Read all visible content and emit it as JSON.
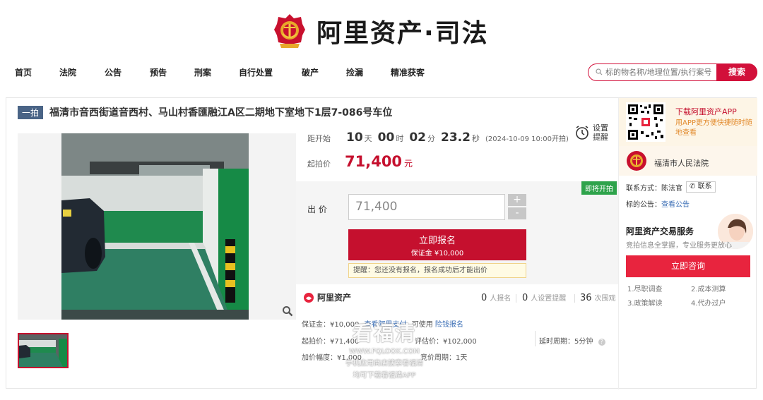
{
  "brand": {
    "name": "阿里资产·司法"
  },
  "nav": {
    "items": [
      "首页",
      "法院",
      "公告",
      "预告",
      "刑案",
      "自行处置",
      "破产",
      "捡漏",
      "精准获客"
    ],
    "search_placeholder": "标的物名称/地理位置/执行案号",
    "search_button": "搜索"
  },
  "item": {
    "tag": "一拍",
    "title": "福清市音西街道音西村、马山村香匯融江A区二期地下室地下1层7-086号车位"
  },
  "countdown": {
    "label": "距开始",
    "days": "10",
    "days_unit": "天",
    "hours": "00",
    "hours_unit": "时",
    "minutes": "02",
    "minutes_unit": "分",
    "seconds": "23.2",
    "seconds_unit": "秒",
    "start_date": "(2024-10-09 10:00开拍)",
    "remind_line1": "设置",
    "remind_line2": "提醒"
  },
  "start_price": {
    "label": "起拍价",
    "value": "71,400",
    "unit": "元"
  },
  "bid": {
    "badge": "即将开拍",
    "label": "出 价",
    "value": "71,400",
    "plus": "+",
    "minus": "-",
    "signup_line1": "立即报名",
    "signup_line2": "保证金 ¥10,000",
    "hint": "提醒：您还没有报名，报名成功后才能出价"
  },
  "stats": {
    "brand": "阿里资产",
    "signup_count": "0",
    "signup_text": "人报名",
    "remind_count": "0",
    "remind_text": "人设置提醒",
    "view_count": "36",
    "view_text": "次围观"
  },
  "details": {
    "deposit_label": "保证金：",
    "deposit_value": "¥10,000",
    "deposit_link": "查看阿里支付",
    "deposit_note": "可使用",
    "deposit_link2": "险钱报名",
    "start_label": "起拍价：",
    "start_value": "¥71,400",
    "eval_label": "评估价：",
    "eval_value": "¥102,000",
    "delay_label": "延时周期：",
    "delay_value": "5分钟",
    "increment_label": "加价幅度：",
    "increment_value": "¥1,000",
    "period_label": "竞价周期：",
    "period_value": "1天"
  },
  "watermark": {
    "big": "看福清",
    "url": "WWW.FQLOOK.COM",
    "line1": "手机应用商店搜索看福清",
    "line2": "均可下载看福清APP"
  },
  "sidebar": {
    "app_title": "下载阿里资产APP",
    "app_sub": "用APP更方便快捷随时随地查看",
    "court_name": "福清市人民法院",
    "contact_label": "联系方式：",
    "contact_name": "陈法官",
    "call_button": "联系",
    "notice_label": "标的公告：",
    "notice_link": "查看公告",
    "service_title": "阿里资产交易服务",
    "service_sub": "竞拍信息全掌握，专业服务更放心",
    "consult_button": "立即咨询",
    "service_links": [
      "1.尽职调查",
      "2.成本测算",
      "3.政策解读",
      "4.代办过户"
    ]
  },
  "colors": {
    "primary_red": "#c5102e",
    "soon_green": "#2ea34b",
    "link_blue": "#3c6fb6"
  }
}
